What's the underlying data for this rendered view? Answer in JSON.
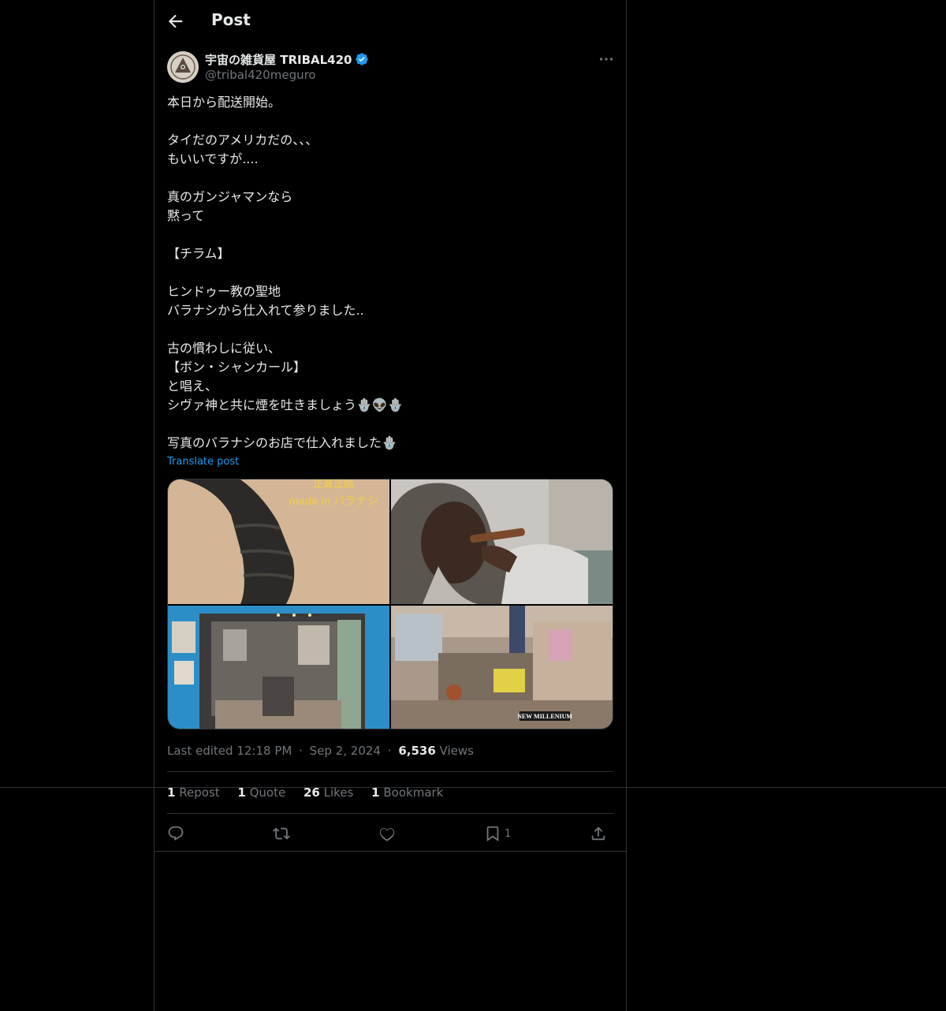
{
  "header": {
    "title": "Post"
  },
  "author": {
    "name": "宇宙の雑貨屋 TRIBAL420",
    "handle": "@tribal420meguro"
  },
  "post": {
    "lines": [
      "本日から配送開始。",
      "",
      "タイだのアメリカだの、、、",
      "もいいですが....",
      "",
      "真のガンジャマンなら",
      "黙って",
      "",
      "【チラム】",
      "",
      "ヒンドゥー教の聖地",
      "バラナシから仕入れて参りました..",
      "",
      "古の慣わしに従い、",
      "【ボン・シャンカール】",
      "と唱え、",
      "シヴァ神と共に煙を吐きましょう🪬👽🪬",
      "",
      "写真のバラナシのお店で仕入れました🪬"
    ],
    "translate_label": "Translate post"
  },
  "media": {
    "image1_text_top": "正真正銘",
    "image1_text": "made in バラナシ",
    "image4_sign": "NEW MILLENIUM"
  },
  "meta": {
    "edited_label": "Last edited 12:18 PM",
    "dot": "·",
    "date": "Sep 2, 2024",
    "views_count": "6,536",
    "views_label": "Views"
  },
  "stats": {
    "reposts_count": "1",
    "reposts_label": "Repost",
    "quotes_count": "1",
    "quotes_label": "Quote",
    "likes_count": "26",
    "likes_label": "Likes",
    "bookmarks_count": "1",
    "bookmarks_label": "Bookmark"
  },
  "actions": {
    "bookmark_count": "1"
  },
  "colors": {
    "accent": "#1d9bf0",
    "muted": "#71767b",
    "border": "#2f3336",
    "text": "#e7e9ea",
    "background": "#000000"
  }
}
